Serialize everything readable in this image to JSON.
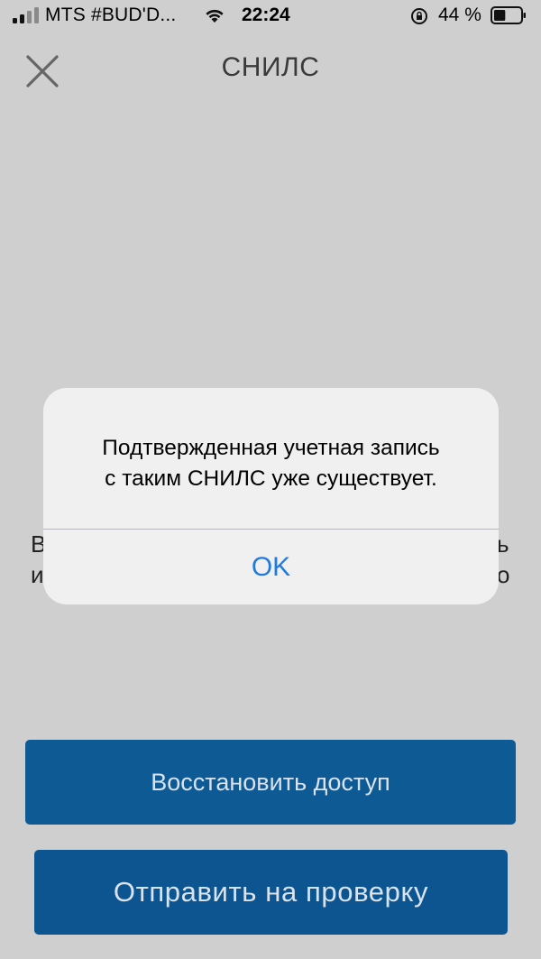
{
  "status_bar": {
    "carrier": "MTS #BUD'D...",
    "time": "22:24",
    "battery_percent": "44 %",
    "battery_level": 0.44,
    "icons": [
      "signal-icon",
      "wifi-icon",
      "rotation-lock-icon",
      "battery-icon"
    ]
  },
  "header": {
    "title": "СНИЛС",
    "close_icon": "close-icon"
  },
  "background_text": {
    "line1_left": "В",
    "line1_right": "ь",
    "line2_left": "и",
    "line2_right": "о"
  },
  "buttons": {
    "restore_label": "Восстановить доступ",
    "send_label": "Отправить на проверку"
  },
  "alert": {
    "message_line1": "Подтвержденная учетная запись",
    "message_line2": "с таким СНИЛС уже существует.",
    "ok_label": "OK"
  },
  "colors": {
    "background": "#cfcfcf",
    "button_blue": "#0d5a95",
    "alert_bg": "#f0f0f0",
    "link_blue": "#1f7be0"
  }
}
